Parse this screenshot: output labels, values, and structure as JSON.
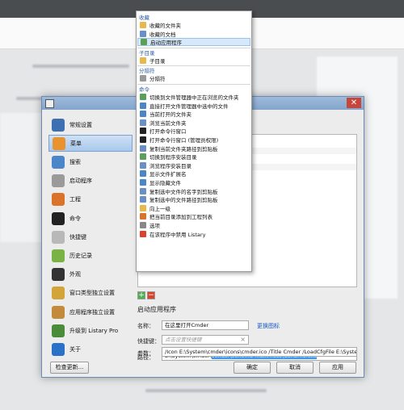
{
  "nav": {
    "items": [
      {
        "label": "常规设置",
        "icon": "settings-icon",
        "color": "#3e6fb0"
      },
      {
        "label": "菜单",
        "icon": "menu-icon",
        "color": "#e8932e"
      },
      {
        "label": "搜索",
        "icon": "search-icon",
        "color": "#4b86c9"
      },
      {
        "label": "启动程序",
        "icon": "launcher-icon",
        "color": "#9a9a9a"
      },
      {
        "label": "工程",
        "icon": "project-icon",
        "color": "#d9742a"
      },
      {
        "label": "命令",
        "icon": "command-icon",
        "color": "#222222"
      },
      {
        "label": "快捷键",
        "icon": "keyboard-icon",
        "color": "#b8b8b8"
      },
      {
        "label": "历史记录",
        "icon": "history-icon",
        "color": "#7ab343"
      },
      {
        "label": "外观",
        "icon": "appearance-icon",
        "color": "#333333"
      },
      {
        "label": "窗口类型独立设置",
        "icon": "window-type-icon",
        "color": "#d2a43a"
      },
      {
        "label": "应用程序独立设置",
        "icon": "app-settings-icon",
        "color": "#c48a3c"
      },
      {
        "label": "升级到 Listary Pro",
        "icon": "upgrade-icon",
        "color": "#4a8c3a"
      },
      {
        "label": "关于",
        "icon": "about-icon",
        "color": "#2a72c8"
      }
    ],
    "selected_index": 1
  },
  "menu": {
    "sections": [
      {
        "header": "收藏",
        "items": [
          {
            "label": "收藏的文件夹",
            "icon": "folder-icon",
            "color": "#e8b84a"
          },
          {
            "label": "收藏的文档",
            "icon": "document-icon",
            "color": "#6a8fc7"
          },
          {
            "label": "启动应用程序",
            "icon": "app-launch-icon",
            "color": "#5aa05a",
            "selected": true
          }
        ]
      },
      {
        "header": "子目录",
        "items": [
          {
            "label": "子目录",
            "icon": "subfolder-icon",
            "color": "#e8b84a"
          }
        ]
      },
      {
        "header": "分隔符",
        "items": [
          {
            "label": "分隔符",
            "icon": "separator-icon",
            "color": "#999999"
          }
        ]
      },
      {
        "header": "命令",
        "items": [
          {
            "label": "切换到文件管理器中正在浏览的文件夹",
            "icon": "switch-folder-icon",
            "color": "#5aa05a"
          },
          {
            "label": "直接打开文件管理器中选中的文件",
            "icon": "open-file-icon",
            "color": "#4b86c9"
          },
          {
            "label": "当前打开的文件夹",
            "icon": "open-folder-icon",
            "color": "#4b86c9"
          },
          {
            "label": "浏览当前文件夹",
            "icon": "browse-folder-icon",
            "color": "#6a8fc7"
          },
          {
            "label": "打开命令行窗口",
            "icon": "cmd-icon",
            "color": "#222222"
          },
          {
            "label": "打开命令行窗口 (管理员权限)",
            "icon": "cmd-admin-icon",
            "color": "#222222"
          },
          {
            "label": "复制当前文件夹路径到剪贴板",
            "icon": "copy-path-icon",
            "color": "#6a8fc7"
          },
          {
            "label": "切换到程序安装目录",
            "icon": "install-dir-icon",
            "color": "#5aa05a"
          },
          {
            "label": "浏览程序安装目录",
            "icon": "browse-install-icon",
            "color": "#6a8fc7"
          },
          {
            "label": "显示文件扩展名",
            "icon": "extension-icon",
            "color": "#4b86c9"
          },
          {
            "label": "显示隐藏文件",
            "icon": "hidden-files-icon",
            "color": "#4b86c9"
          },
          {
            "label": "复制选中文件的名字到剪贴板",
            "icon": "copy-name-icon",
            "color": "#6a8fc7"
          },
          {
            "label": "复制选中的文件路径到剪贴板",
            "icon": "copy-file-path-icon",
            "color": "#6a8fc7"
          },
          {
            "label": "向上一级",
            "icon": "up-level-icon",
            "color": "#e8b84a"
          },
          {
            "label": "把当前目录添加到工程列表",
            "icon": "add-project-icon",
            "color": "#d9742a"
          },
          {
            "label": "选项",
            "icon": "options-icon",
            "color": "#888888"
          },
          {
            "label": "在该程序中禁用 Listary",
            "icon": "disable-icon",
            "color": "#d9432e"
          }
        ]
      }
    ]
  },
  "editor": {
    "section_title": "启动应用程序",
    "name_label": "名称：",
    "name_value": "在这里打开Cmder",
    "change_icon_link": "更换图标",
    "hotkey_label": "快捷键：",
    "hotkey_placeholder": "点击设置快捷键",
    "path_label": "路径：",
    "path_prefix": "E:\\System\\cmder\\",
    "path_highlight": "vendor\\conemu-maximus5\\ConEmu.exe",
    "args_label": "参数：",
    "args_value": "/Icon E:\\System\\cmder\\icons\\cmder.ico /Title Cmder /LoadCfgFile E:\\System"
  },
  "buttons": {
    "check_updates": "检查更新...",
    "ok": "确定",
    "cancel": "取消",
    "apply": "应用",
    "add": "+",
    "remove": "−",
    "close": "✕"
  }
}
